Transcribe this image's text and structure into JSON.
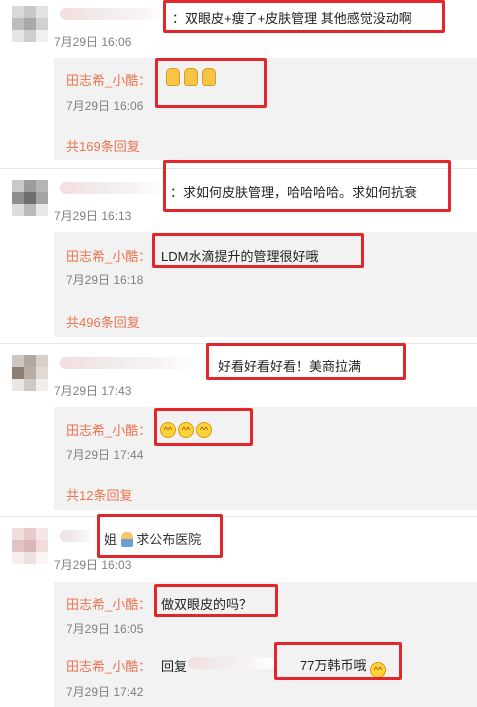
{
  "comments": [
    {
      "text": "：双眼皮+瘦了+皮肤管理 其他感觉没动啊",
      "date": "7月29日 16:06",
      "replies": [
        {
          "author": "田志希_小酷：",
          "text": "",
          "date": "7月29日 16:06",
          "emoji": "thumbs-up-icon x3"
        }
      ],
      "more": "共169条回复"
    },
    {
      "text": "：求如何皮肤管理，哈哈哈哈。求如何抗衰",
      "date": "7月29日 16:13",
      "replies": [
        {
          "author": "田志希_小酷：",
          "text": "LDM水滴提升的管理很好哦",
          "date": "7月29日 16:18"
        }
      ],
      "more": "共496条回复"
    },
    {
      "text": "好看好看好看！美商拉满",
      "date": "7月29日 17:43",
      "replies": [
        {
          "author": "田志希_小酷：",
          "text": "",
          "date": "7月29日 17:44",
          "emoji": "laughing-face-icon x3"
        }
      ],
      "more": "共12条回复"
    },
    {
      "text_before": "姐",
      "text_after": "求公布医院",
      "date": "7月29日 16:03",
      "replies": [
        {
          "author": "田志希_小酷：",
          "text": "做双眼皮的吗？",
          "date": "7月29日 16:05"
        },
        {
          "author": "田志希_小酷：",
          "reply_prefix": "回复",
          "text": "77万韩币哦",
          "date": "7月29日 17:42"
        }
      ]
    }
  ],
  "colors": {
    "accent": "#eb7350",
    "highlight_box": "#e3262b",
    "reply_bg": "#f2f2f2"
  }
}
